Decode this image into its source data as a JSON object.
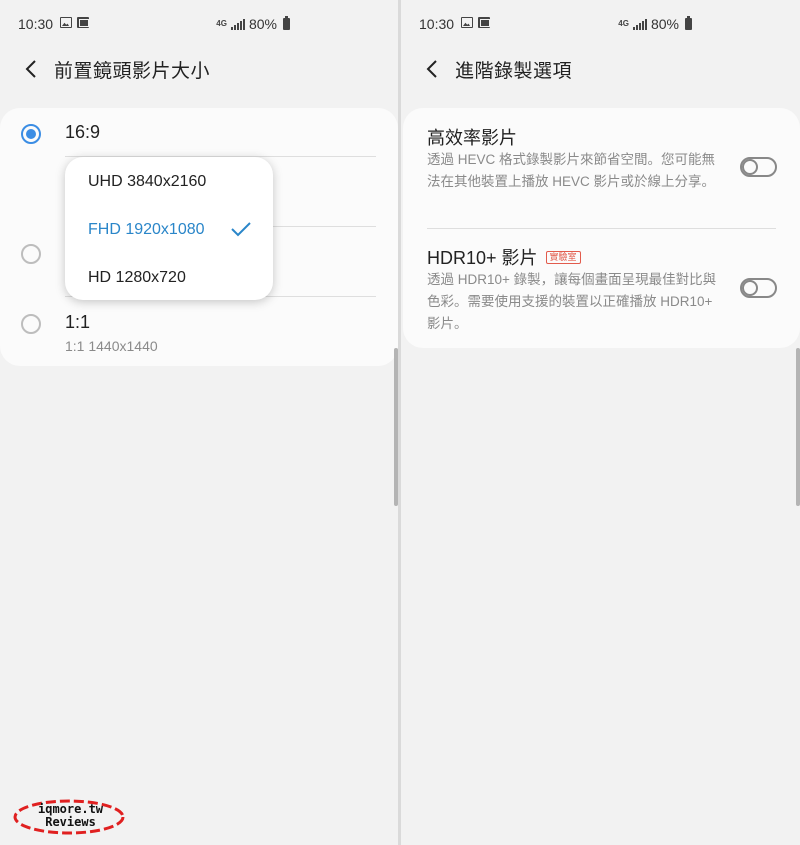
{
  "status_left": {
    "time": "10:30",
    "network": "4G",
    "battery": "80%"
  },
  "status_right": {
    "time": "10:30",
    "network": "4G",
    "battery": "80%"
  },
  "left_screen": {
    "title": "前置鏡頭影片大小",
    "options": [
      {
        "label": "16:9",
        "sublabel": "",
        "selected": true
      },
      {
        "label": "",
        "sublabel": "",
        "selected": false
      },
      {
        "label": "1:1",
        "sublabel": "1:1 1440x1440",
        "selected": false
      }
    ],
    "popup": {
      "items": [
        {
          "label": "UHD 3840x2160",
          "selected": false
        },
        {
          "label": "FHD 1920x1080",
          "selected": true
        },
        {
          "label": "HD 1280x720",
          "selected": false
        }
      ]
    }
  },
  "right_screen": {
    "title": "進階錄製選項",
    "settings": [
      {
        "title": "高效率影片",
        "badge": "",
        "description": "透過 HEVC 格式錄製影片來節省空間。您可能無法在其他裝置上播放 HEVC 影片或於線上分享。",
        "enabled": false
      },
      {
        "title": "HDR10+ 影片",
        "badge": "實驗室",
        "description": "透過 HDR10+ 錄製，讓每個畫面呈現最佳對比與色彩。需要使用支援的裝置以正確播放 HDR10+ 影片。",
        "enabled": false
      }
    ]
  },
  "watermark": {
    "line1": "iqmore.tw",
    "line2": "Reviews"
  },
  "colors": {
    "accent": "#3b8de4",
    "selected_text": "#2a86c9",
    "badge": "#e25b4c"
  }
}
